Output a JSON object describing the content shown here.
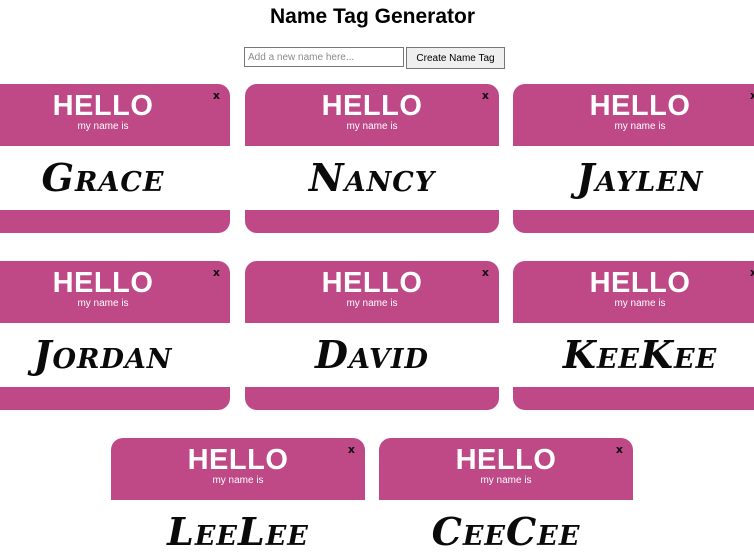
{
  "app": {
    "title": "Name Tag Generator"
  },
  "form": {
    "input_placeholder": "Add a new name here...",
    "input_value": "",
    "button_label": "Create Name Tag"
  },
  "tag_template": {
    "hello": "HELLO",
    "subtitle": "my name is",
    "close": "x"
  },
  "tags": [
    {
      "name": "Grace"
    },
    {
      "name": "Nancy"
    },
    {
      "name": "Jaylen"
    },
    {
      "name": "Jordan"
    },
    {
      "name": "David"
    },
    {
      "name": "KeeKee"
    },
    {
      "name": "LeeLee"
    },
    {
      "name": "CeeCee"
    }
  ],
  "colors": {
    "tag_accent": "#bf4886",
    "tag_body": "#ffffff",
    "name_text": "#0a0a0a"
  },
  "icons": {
    "close": "close-icon"
  }
}
